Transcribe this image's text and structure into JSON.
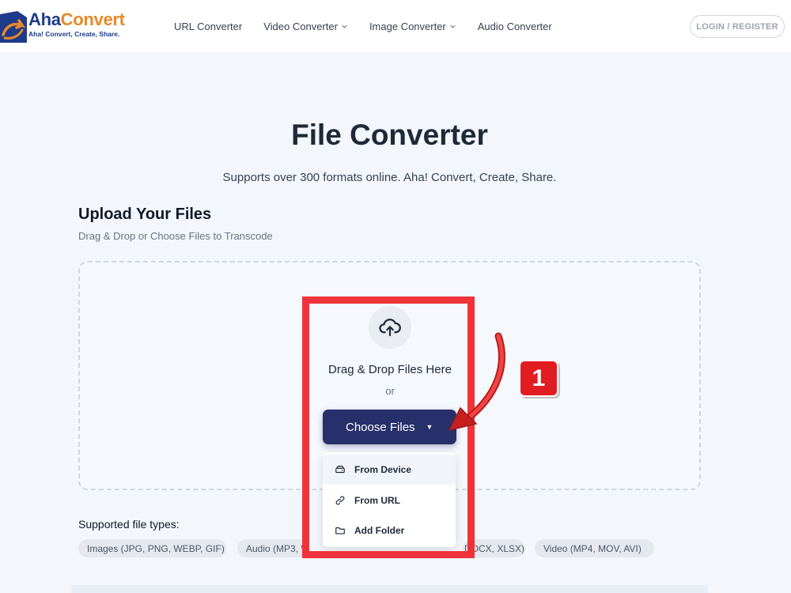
{
  "header": {
    "logo": {
      "name_part1": "Aha",
      "name_part2": "Convert",
      "tagline": "Aha! Convert, Create, Share."
    },
    "nav": [
      {
        "label": "URL Converter",
        "has_dropdown": false
      },
      {
        "label": "Video Converter",
        "has_dropdown": true
      },
      {
        "label": "Image Converter",
        "has_dropdown": true
      },
      {
        "label": "Audio Converter",
        "has_dropdown": false
      }
    ],
    "login_label": "LOGIN / REGISTER"
  },
  "hero": {
    "title": "File Converter",
    "subtitle": "Supports over 300 formats online. Aha! Convert, Create, Share."
  },
  "upload": {
    "heading": "Upload Your Files",
    "description": "Drag & Drop or Choose Files to Transcode",
    "drop_text": "Drag & Drop Files Here",
    "or_text": "or",
    "choose_label": "Choose Files",
    "menu": [
      {
        "label": "From Device",
        "icon": "drive-icon"
      },
      {
        "label": "From URL",
        "icon": "link-icon"
      },
      {
        "label": "Add Folder",
        "icon": "folder-icon"
      }
    ]
  },
  "supported": {
    "label": "Supported file types:",
    "types": [
      "Images (JPG, PNG, WEBP, GIF)",
      "Audio (MP3, WAV",
      "DOCX, XLSX)",
      "Video (MP4, MOV, AVI)"
    ]
  },
  "annotation": {
    "step_number": "1"
  },
  "colors": {
    "primary": "#27306b",
    "accent_orange": "#e8892a",
    "brand_blue": "#1e3a8a",
    "annotation_red": "#f0333a"
  }
}
